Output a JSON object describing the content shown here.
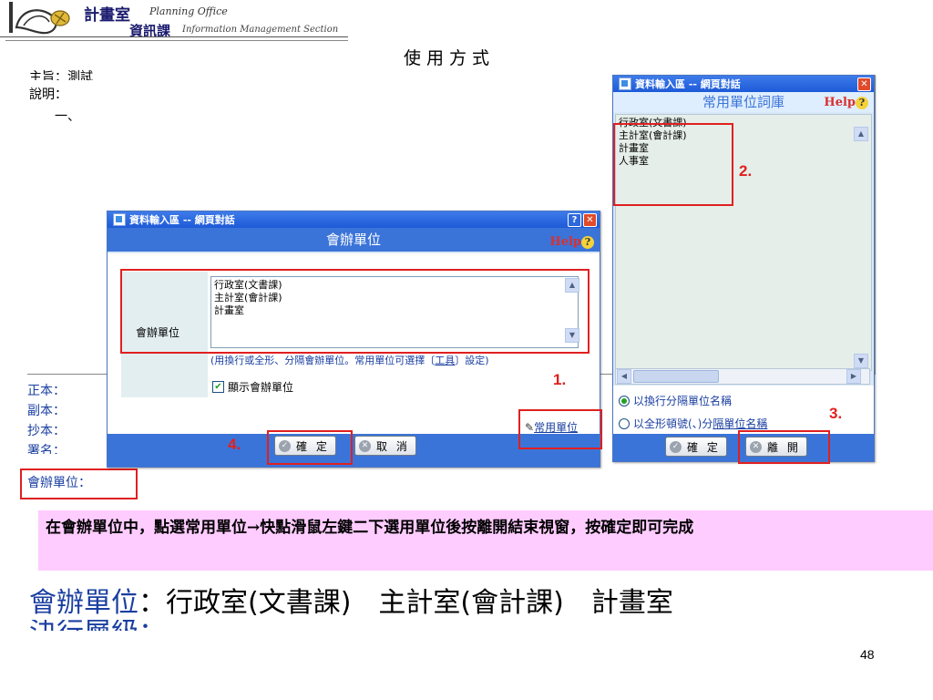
{
  "header": {
    "logo_title": "計畫室",
    "logo_sub_en1": "Planning Office",
    "logo_title2": "資訊課",
    "logo_sub_en2": "Information Management Section",
    "slide_title": "使用方式"
  },
  "form": {
    "subject_label": "主旨：測試",
    "description_label": "說明：",
    "item_one": "一、",
    "fields": [
      "正本：",
      "副本：",
      "抄本：",
      "署名："
    ],
    "co_unit_label": "會辦單位："
  },
  "dialog_main": {
    "titlebar": "資料輸入區 -- 網頁對話",
    "heading": "會辦單位",
    "help_text": "Help",
    "field_label": "會辦單位",
    "list_items": [
      "行政室(文書課)",
      "主計室(會計課)",
      "計畫室"
    ],
    "hint_prefix": "(用換行或全形、分隔會辦單位。常用單位可選擇〔",
    "hint_link": "工具",
    "hint_suffix": "〕設定)",
    "checkbox_label": "顯示會辦單位",
    "checkbox_checked": true,
    "common_units_link": "常用單位",
    "ok_button": "確 定",
    "cancel_button": "取 消"
  },
  "dialog_lexicon": {
    "titlebar": "資料輸入區 -- 網頁對話",
    "heading": "常用單位詞庫",
    "help_text": "Help",
    "list_items": [
      "行政室(文書課)",
      "主計室(會計課)",
      "計畫室",
      "人事室"
    ],
    "option_newline": "以換行分隔單位名稱",
    "option_fullwidth_prefix": "以全形頓號(、)分",
    "option_fullwidth_link": "隔單位名稱",
    "selected_option": "newline",
    "ok_button": "確 定",
    "leave_button": "離 開"
  },
  "step_markers": [
    "1.",
    "2.",
    "3.",
    "4."
  ],
  "instruction_note": "在會辦單位中，點選常用單位→快點滑鼠左鍵二下選用單位後按離開結束視窗，按確定即可完成",
  "result_line": {
    "label": "會辦單位",
    "value": "：行政室(文書課)　主計室(會計課)　計畫室"
  },
  "cut_off_line": "決行層級：",
  "page_number": "48",
  "colors": {
    "highlight_red": "#e02020",
    "note_background": "#ffccff",
    "dialog_header_blue": "#3b74d8",
    "label_blue": "#1a3fa0"
  }
}
